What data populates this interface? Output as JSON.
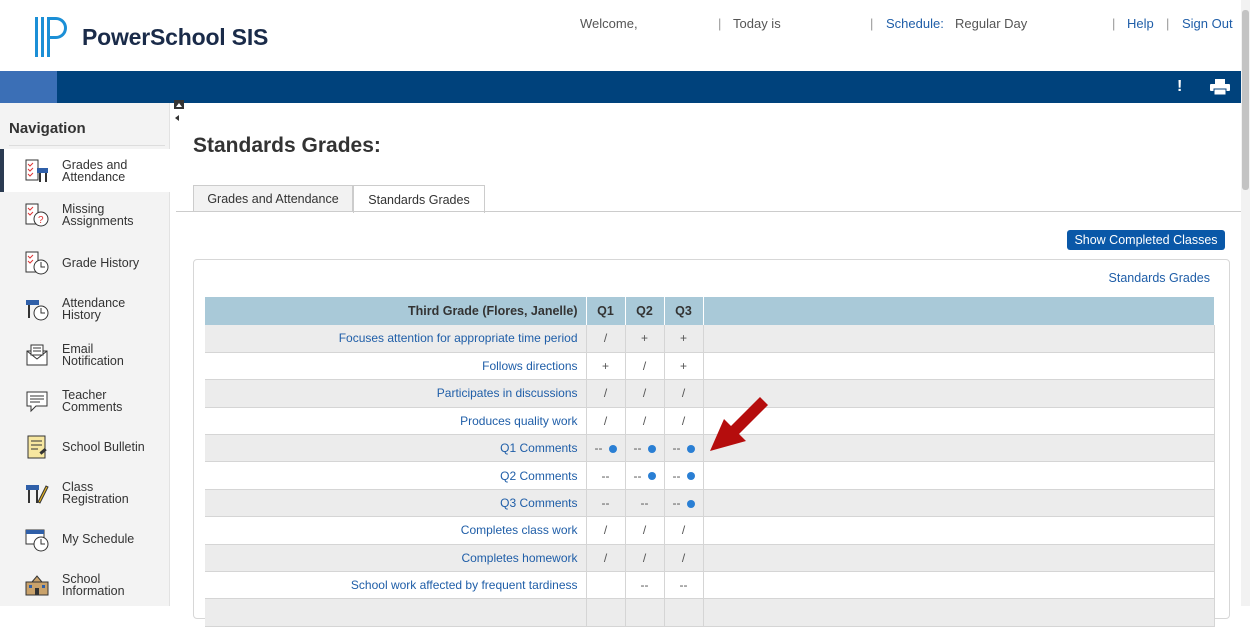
{
  "brand": "PowerSchool SIS",
  "topbar": {
    "welcome": "Welcome,",
    "today": "Today is",
    "schedule_label": "Schedule:",
    "schedule_value": "Regular Day",
    "help": "Help",
    "sign_out": "Sign Out",
    "separator": "|"
  },
  "band": {
    "alert": "!"
  },
  "navigation": {
    "title": "Navigation",
    "items": [
      {
        "label": "Grades and\nAttendance",
        "icon": "grades-attendance-icon"
      },
      {
        "label": "Missing\nAssignments",
        "icon": "missing-assignments-icon"
      },
      {
        "label": "Grade History",
        "icon": "grade-history-icon"
      },
      {
        "label": "Attendance\nHistory",
        "icon": "attendance-history-icon"
      },
      {
        "label": "Email\nNotification",
        "icon": "email-icon"
      },
      {
        "label": "Teacher\nComments",
        "icon": "comment-icon"
      },
      {
        "label": "School Bulletin",
        "icon": "bulletin-icon"
      },
      {
        "label": "Class\nRegistration",
        "icon": "registration-icon"
      },
      {
        "label": "My Schedule",
        "icon": "schedule-icon"
      },
      {
        "label": "School\nInformation",
        "icon": "school-icon"
      }
    ]
  },
  "page_title": "Standards Grades:",
  "tabs": [
    "Grades and Attendance",
    "Standards Grades"
  ],
  "show_completed_button": "Show Completed Classes",
  "panel_link": "Standards Grades",
  "table": {
    "header": [
      "Third Grade (Flores, Janelle)",
      "Q1",
      "Q2",
      "Q3"
    ],
    "rows": [
      {
        "standard": "Focuses attention for appropriate time period",
        "q": [
          "/",
          "+",
          "+"
        ],
        "dots": [
          false,
          false,
          false
        ]
      },
      {
        "standard": "Follows directions",
        "q": [
          "+",
          "/",
          "+"
        ],
        "dots": [
          false,
          false,
          false
        ]
      },
      {
        "standard": "Participates in discussions",
        "q": [
          "/",
          "/",
          "/"
        ],
        "dots": [
          false,
          false,
          false
        ]
      },
      {
        "standard": "Produces quality work",
        "q": [
          "/",
          "/",
          "/"
        ],
        "dots": [
          false,
          false,
          false
        ]
      },
      {
        "standard": "Q1 Comments",
        "q": [
          "--",
          "--",
          "--"
        ],
        "dots": [
          true,
          true,
          true
        ]
      },
      {
        "standard": "Q2 Comments",
        "q": [
          "--",
          "--",
          "--"
        ],
        "dots": [
          false,
          true,
          true
        ]
      },
      {
        "standard": "Q3 Comments",
        "q": [
          "--",
          "--",
          "--"
        ],
        "dots": [
          false,
          false,
          true
        ]
      },
      {
        "standard": "Completes class work",
        "q": [
          "/",
          "/",
          "/"
        ],
        "dots": [
          false,
          false,
          false
        ]
      },
      {
        "standard": "Completes homework",
        "q": [
          "/",
          "/",
          "/"
        ],
        "dots": [
          false,
          false,
          false
        ]
      },
      {
        "standard": "School work affected by frequent tardiness",
        "q": [
          "",
          "--",
          "--"
        ],
        "dots": [
          false,
          false,
          false
        ]
      },
      {
        "standard": "",
        "q": [
          "",
          "",
          ""
        ],
        "dots": [
          false,
          false,
          false
        ]
      }
    ]
  },
  "colors": {
    "band": "#00427c",
    "accent": "#0a58a8",
    "table_header": "#a9c9d8",
    "arrow": "#b50d0d",
    "dot": "#2a7fd4"
  }
}
